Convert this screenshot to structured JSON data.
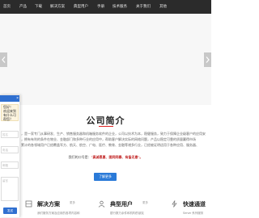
{
  "nav": {
    "items": [
      "首页",
      "产品",
      "下载",
      "解决方案",
      "典型用户",
      "手册",
      "技术服务",
      "关于我们",
      "其他"
    ]
  },
  "intro": {
    "title": "公司简介",
    "lines": [
      "，是一家专门从事研发、生产、销售服务器和机箱服务软件的企业，公司以技术为本，稳健服务，致力于保障企业级客户的应用安",
      "，拥有有利的条件在物业、金融部门和多种行业的应用中，帮助客户解决实际的网络问题，产品以稳定可靠的质量赢得市场",
      "累计的各领域用户已经覆盖军方、航天、航空、广电、医疗、教育、金融等诸多行业，已经被证明适用于各种应用、服务器、"
    ],
    "slogan_prefix": "我们的口号是：",
    "slogan_bold": "\"真诚恩惠、图同同春、有备无患\"。",
    "more_button": "了解更多"
  },
  "categories": [
    {
      "title": "解决方案",
      "tag": "更多",
      "sub": "我们服务方案及应用的各项内容和"
    },
    {
      "title": "典型用户",
      "tag": "更多",
      "sub": "银行数万余件和机构的朋友"
    },
    {
      "title": "快速通道",
      "tag": "",
      "sub": "Server 系列服务"
    }
  ],
  "chat": {
    "close": "×",
    "msg_lines": [
      "您好！",
      "欢迎来到",
      "有什么可",
      "帮您？"
    ],
    "fields": [
      "姓名",
      "电话",
      "邮箱",
      "留言"
    ],
    "send": "发送"
  }
}
